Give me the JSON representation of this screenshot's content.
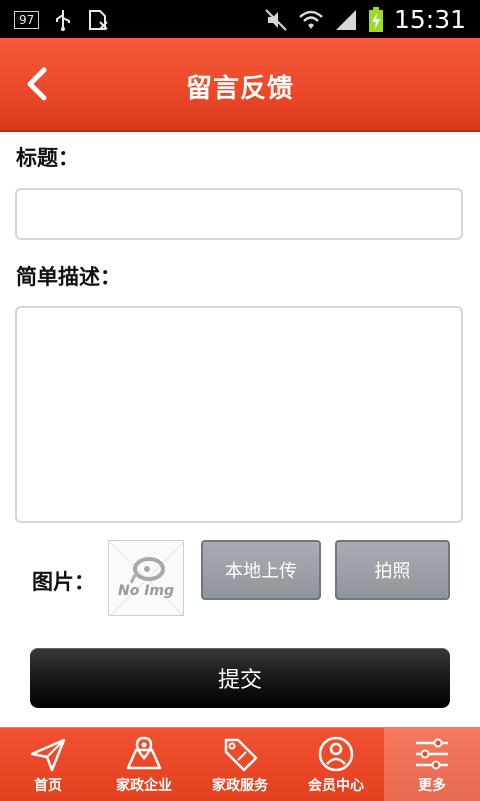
{
  "status_bar": {
    "badge": "97",
    "time": "15:31",
    "icons": [
      "usb-icon",
      "sim-icon",
      "mute-icon",
      "wifi-icon",
      "signal-icon",
      "battery-charging-icon"
    ]
  },
  "header": {
    "title": "留言反馈",
    "back_icon": "chevron-left-icon"
  },
  "form": {
    "title_label": "标题：",
    "title_value": "",
    "desc_label": "简单描述：",
    "desc_value": "",
    "image_label": "图片：",
    "no_img_text": "No Img",
    "upload_label": "本地上传",
    "camera_label": "拍照",
    "submit_label": "提交"
  },
  "bottom_nav": {
    "items": [
      {
        "label": "首页",
        "icon": "paper-plane-icon"
      },
      {
        "label": "家政企业",
        "icon": "map-icon"
      },
      {
        "label": "家政服务",
        "icon": "sale-tag-icon"
      },
      {
        "label": "会员中心",
        "icon": "user-circle-icon"
      },
      {
        "label": "更多",
        "icon": "sliders-icon"
      }
    ],
    "active_index": 4
  },
  "colors": {
    "header": "#ec4a2a",
    "nav": "#e84826",
    "gray_button": "#9aa0a6",
    "submit": "#111111"
  }
}
